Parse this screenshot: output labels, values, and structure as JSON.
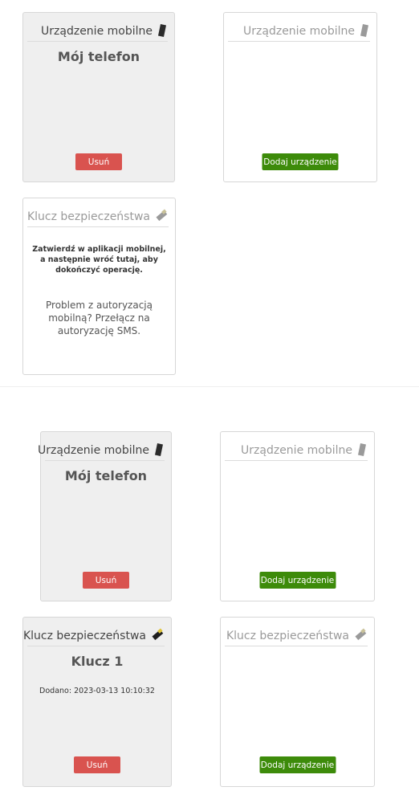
{
  "section1": {
    "device_card": {
      "header": "Urządzenie mobilne",
      "icon": "phone-icon",
      "device_name": "Mój telefon",
      "remove_label": "Usuń"
    },
    "empty_device_card": {
      "header": "Urządzenie mobilne",
      "icon": "phone-icon",
      "add_label": "Dodaj urządzenie"
    },
    "key_card": {
      "header": "Klucz bezpieczeństwa",
      "icon": "usb-key-icon",
      "confirm_line1": "Zatwierdź w aplikacji mobilnej,",
      "confirm_line2": "a następnie wróć tutaj, aby dokończyć operację.",
      "problem_text": "Problem z autoryzacją mobilną? Przełącz na autoryzację SMS."
    }
  },
  "section2": {
    "device_card": {
      "header": "Urządzenie mobilne",
      "icon": "phone-icon",
      "device_name": "Mój telefon",
      "remove_label": "Usuń"
    },
    "empty_device_card": {
      "header": "Urządzenie mobilne",
      "icon": "phone-icon",
      "add_label": "Dodaj urządzenie"
    },
    "key_card": {
      "header": "Klucz bezpieczeństwa",
      "icon": "usb-key-icon",
      "key_name": "Klucz 1",
      "added": "Dodano: 2023-03-13 10:10:32",
      "remove_label": "Usuń"
    },
    "empty_key_card": {
      "header": "Klucz bezpieczeństwa",
      "icon": "usb-key-icon",
      "add_label": "Dodaj urządzenie"
    }
  },
  "colors": {
    "remove_button": "#d9534f",
    "add_button": "#3d8b0a",
    "filled_card": "#efefef"
  }
}
